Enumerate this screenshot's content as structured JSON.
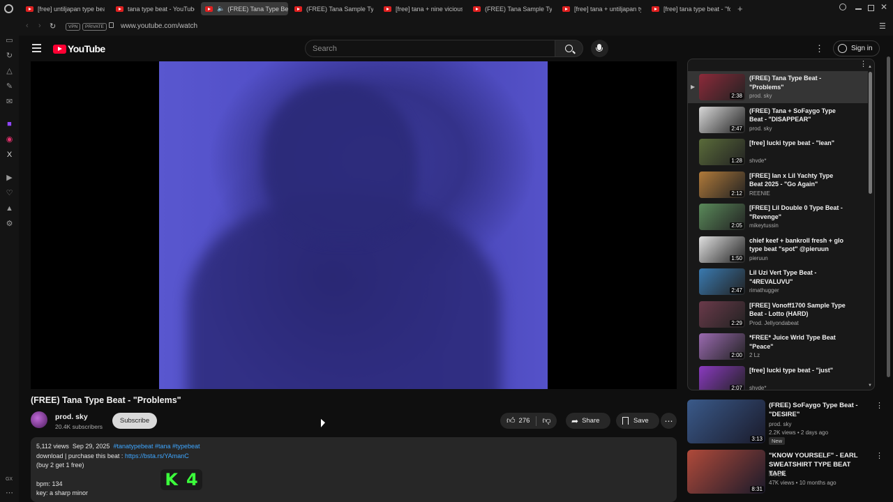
{
  "tabs": [
    {
      "title": "[free] untiljapan type beat",
      "active": false
    },
    {
      "title": "tana type beat - YouTube",
      "active": false
    },
    {
      "title": "(FREE) Tana Type Beat",
      "active": true
    },
    {
      "title": "(FREE) Tana Sample Type",
      "active": false
    },
    {
      "title": "[free] tana + nine vicious",
      "active": false
    },
    {
      "title": "(FREE) Tana Sample Type",
      "active": false
    },
    {
      "title": "[free] tana + untiljapan ty",
      "active": false
    },
    {
      "title": "[free] tana type beat - \"fo",
      "active": false
    }
  ],
  "address_bar": {
    "vpn_label": "VPN",
    "private_label": "PRIVATE",
    "url": "www.youtube.com/watch"
  },
  "sidebar_bottom_label": "GX",
  "header": {
    "logo_text": "YouTube",
    "search_placeholder": "Search",
    "signin_label": "Sign in"
  },
  "video": {
    "title": "(FREE) Tana Type Beat - \"Problems\"",
    "channel": "prod. sky",
    "subscribers": "20.4K subscribers",
    "subscribe_label": "Subscribe",
    "likes": "276",
    "share_label": "Share",
    "save_label": "Save"
  },
  "description": {
    "views": "5,112 views",
    "date": "Sep 29, 2025",
    "tags": "#tanatypebeat #tana #typebeat",
    "line1_prefix": "download | purchase this beat :",
    "line1_link": "https://bsta.rs/YAmanC",
    "line2": "(buy 2 get 1 free)",
    "line3": "bpm: 134",
    "line4": "key: a sharp minor",
    "badge_k": "K",
    "badge_num": "4"
  },
  "playlist": [
    {
      "title": "(FREE) Tana Type Beat - \"Problems\"",
      "channel": "prod. sky",
      "duration": "2:38",
      "current": true,
      "color": "#8c2a3a"
    },
    {
      "title": "(FREE) Tana + SoFaygo Type Beat - \"DISAPPEAR\"",
      "channel": "prod. sky",
      "duration": "2:47",
      "current": false,
      "color": "#d8d8d8"
    },
    {
      "title": "[free] lucki type beat - \"lean\"",
      "channel": "shvde*",
      "duration": "1:28",
      "current": false,
      "color": "#5a6b3a"
    },
    {
      "title": "[FREE] Ian x Lil Yachty Type Beat 2025 - \"Go Again\"",
      "channel": "REENIE",
      "duration": "2:12",
      "current": false,
      "color": "#b07a3a"
    },
    {
      "title": "[FREE] Lil Double 0 Type Beat - \"Revenge\"",
      "channel": "mikeytussin",
      "duration": "2:05",
      "current": false,
      "color": "#5a8a5a"
    },
    {
      "title": "chief keef + bankroll fresh + glo type beat \"spot\" @pieruun",
      "channel": "pieruun",
      "duration": "1:50",
      "current": false,
      "color": "#e0e0e0"
    },
    {
      "title": "Lil Uzi Vert Type Beat - \"4REVALUVU\"",
      "channel": "rimathugger",
      "duration": "2:47",
      "current": false,
      "color": "#3a7ab0"
    },
    {
      "title": "[FREE] Vonoff1700 Sample Type Beat - Lotto (HARD)",
      "channel": "Prod. Jellyondabeat",
      "duration": "2:29",
      "current": false,
      "color": "#6a3a4a"
    },
    {
      "title": "*FREE* Juice Wrld Type Beat \"Peace\"",
      "channel": "2 Lz",
      "duration": "2:00",
      "current": false,
      "color": "#9a6ab0"
    },
    {
      "title": "[free] lucki type beat - \"just\"",
      "channel": "shvde*",
      "duration": "2:07",
      "current": false,
      "color": "#8a3ac0"
    }
  ],
  "recommendations": [
    {
      "title": "(FREE) SoFaygo Type Beat - \"DESIRE\"",
      "channel": "prod. sky",
      "meta": "2.2K views • 2 days ago",
      "badge": "New",
      "duration": "3:13",
      "color": "#3a5a8a"
    },
    {
      "title": "\"KNOW YOURSELF\" - EARL SWEATSHIRT TYPE BEAT TAPE",
      "channel": "NOUR.",
      "meta": "47K views • 10 months ago",
      "badge": "",
      "duration": "8:31",
      "color": "#b04a3a"
    }
  ]
}
